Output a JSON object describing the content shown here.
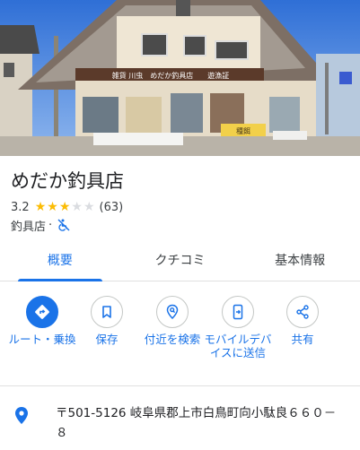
{
  "place": {
    "name": "めだか釣具店",
    "rating": "3.2",
    "stars_filled": 3,
    "stars_total": 5,
    "review_count": "(63)",
    "category": "釣具店",
    "separator": "·",
    "accessibility_icon": "wheelchair-not-accessible-icon",
    "photo_sign_text": "雑貨 川虫　めだか釣具店　　遊漁証",
    "photo_shop_sign": "種餌"
  },
  "tabs": [
    {
      "label": "概要",
      "active": true
    },
    {
      "label": "クチコミ",
      "active": false
    },
    {
      "label": "基本情報",
      "active": false
    }
  ],
  "actions": [
    {
      "label": "ルート・乗換",
      "icon": "directions-icon"
    },
    {
      "label": "保存",
      "icon": "bookmark-icon"
    },
    {
      "label": "付近を検索",
      "icon": "nearby-icon"
    },
    {
      "label": "モバイルデバイスに送信",
      "icon": "send-to-phone-icon"
    },
    {
      "label": "共有",
      "icon": "share-icon"
    }
  ],
  "address": {
    "icon": "location-pin-icon",
    "text": "〒501-5126 岐阜県郡上市白鳥町向小駄良６６０－８"
  },
  "colors": {
    "accent": "#1a73e8",
    "star": "#fbbc04",
    "star_empty": "#dadce0"
  }
}
